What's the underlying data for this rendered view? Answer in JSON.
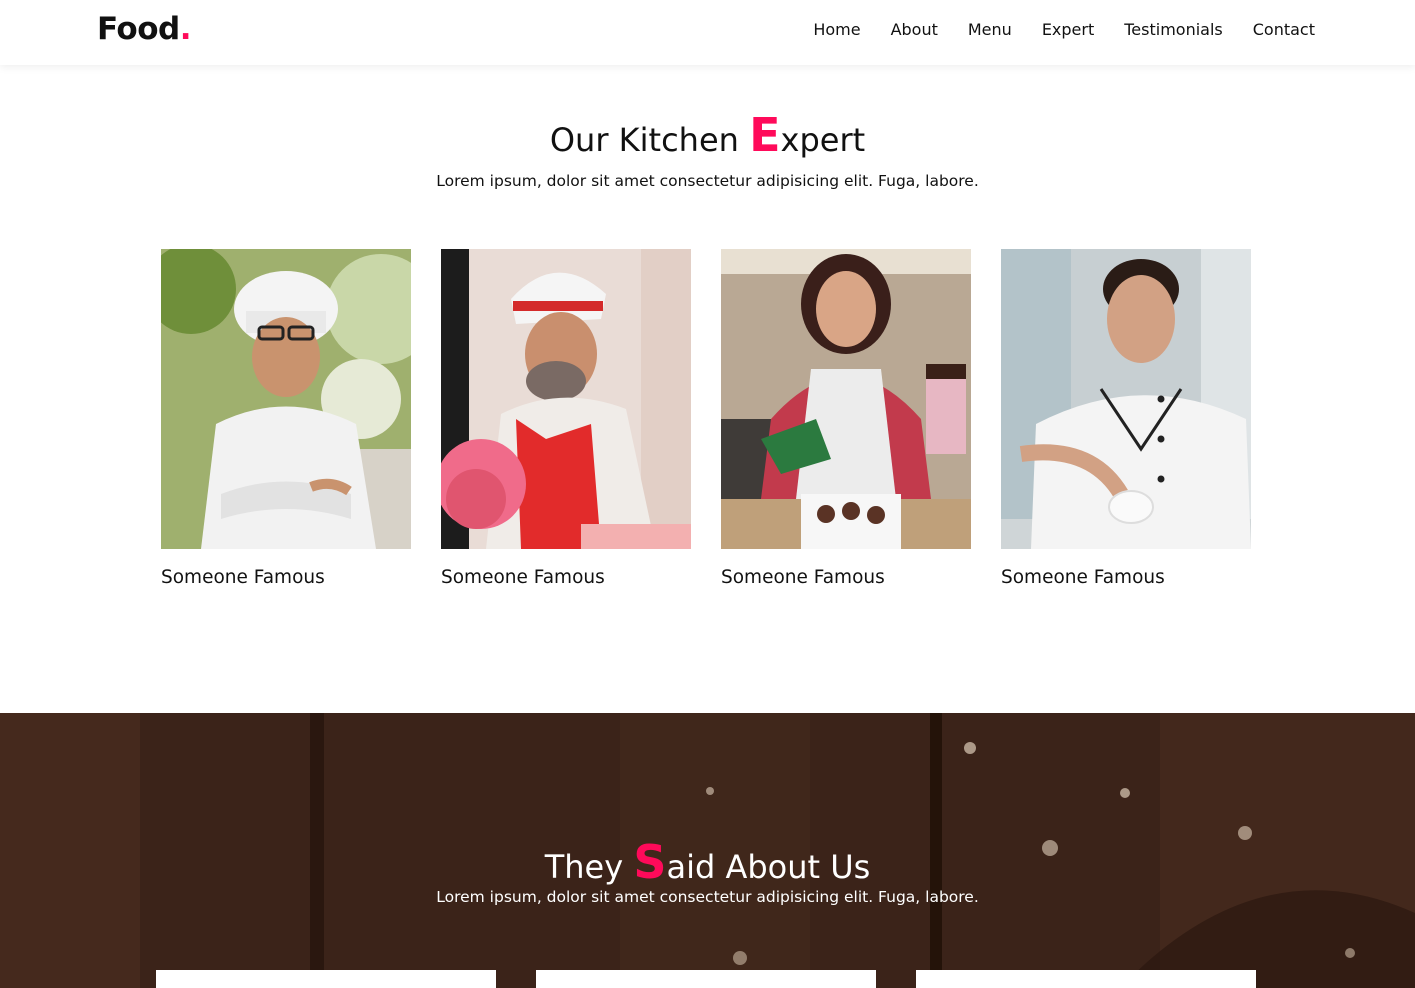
{
  "brand": {
    "name": "Food",
    "dot": "."
  },
  "nav": {
    "items": [
      "Home",
      "About",
      "Menu",
      "Expert",
      "Testimonials",
      "Contact"
    ]
  },
  "expert": {
    "title_before": "Our Kitchen ",
    "title_accent": "E",
    "title_after": "xpert",
    "subtitle": "Lorem ipsum, dolor sit amet consectetur adipisicing elit. Fuga, labore.",
    "chefs": [
      {
        "name": "Someone Famous"
      },
      {
        "name": "Someone Famous"
      },
      {
        "name": "Someone Famous"
      },
      {
        "name": "Someone Famous"
      }
    ]
  },
  "testimonials": {
    "title_before": "They ",
    "title_accent": "S",
    "title_after": "aid About Us",
    "subtitle": "Lorem ipsum, dolor sit amet consectetur adipisicing elit. Fuga, labore."
  },
  "colors": {
    "accent": "#ff0a5a",
    "wood": "#3b2319"
  }
}
